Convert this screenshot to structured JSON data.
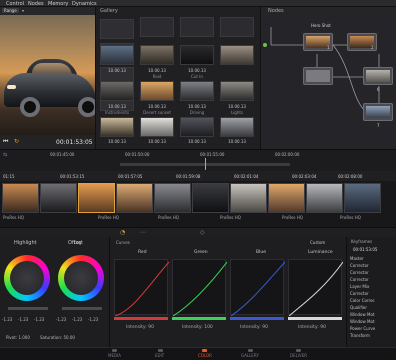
{
  "menubar": {
    "items": [
      "Control",
      "Nodes",
      "Memory",
      "Dynamics"
    ]
  },
  "viewer": {
    "dropdown": "Range",
    "timecode": "00:01:53:05"
  },
  "gallery": {
    "title": "Gallery",
    "thumbs": [
      {
        "tc": "10.00.13",
        "name": ""
      },
      {
        "tc": "10.00.13",
        "name": "Raid"
      },
      {
        "tc": "10.00.13",
        "name": "Cut In"
      },
      {
        "tc": "10.00.13",
        "name": "Instruments"
      },
      {
        "tc": "10.00.13",
        "name": "Desert sunset"
      },
      {
        "tc": "10.00.13",
        "name": "Driving"
      },
      {
        "tc": "10.00.13",
        "name": "Lights"
      },
      {
        "tc": "10.00.13",
        "name": ""
      },
      {
        "tc": "10.00.13",
        "name": ""
      },
      {
        "tc": "10.00.13",
        "name": ""
      },
      {
        "tc": "10.00.13",
        "name": ""
      }
    ]
  },
  "nodes": {
    "title": "Nodes",
    "node_title": "Hero Shot",
    "numbers": [
      "1",
      "2",
      "6",
      "7",
      "8"
    ]
  },
  "timeline": {
    "ruler": [
      "00:01:45:00",
      "00:01:50:00",
      "00:01:55:00",
      "00:02:00:00"
    ],
    "playhead_tc": "00:01:53:05",
    "clips": [
      {
        "tc": "01:15",
        "fmt": "ProRes HQ"
      },
      {
        "tc": "00:01:53:15",
        "fmt": "ProRes HQ"
      },
      {
        "tc": "00:01:57:05",
        "fmt": "ProRes HQ"
      },
      {
        "tc": "00:01:59:08",
        "fmt": "ProRes HQ"
      },
      {
        "tc": "00:02:01:04",
        "fmt": "ProRes HQ"
      },
      {
        "tc": "00:02:03:04",
        "fmt": "ProRes HQ"
      },
      {
        "tc": "00:02:08:00",
        "fmt": "ProRes HQ"
      },
      {
        "tc": "00:02:14:00",
        "fmt": "ProRes HQ"
      }
    ]
  },
  "color": {
    "wheels_header": [
      "Highlight",
      "Offset"
    ],
    "wheels_mode": "Log",
    "wheel_values": [
      "-1.23",
      "-1.23",
      "-1.23",
      "-1.23",
      "-1.23",
      "-1.23"
    ],
    "pivot": "Pivot: 1.000",
    "saturation": "Saturation: 50.00",
    "curves_title": "Curves",
    "curves": [
      {
        "name": "Red",
        "intensity": "Intensity: 90",
        "color": "#d23b3b"
      },
      {
        "name": "Green",
        "intensity": "Intensity: 100",
        "color": "#3bd25a"
      },
      {
        "name": "Blue",
        "intensity": "Intensity: 90",
        "color": "#3b5ad2"
      },
      {
        "name": "Luminance",
        "intensity": "Intensity: 90",
        "color": "#d9d9d9"
      }
    ],
    "custom": "Custom",
    "keyframes_title": "Keyframes",
    "keyframes_tc": "00:01:53:05",
    "keyframes": [
      "Master",
      "Corrector",
      "Corrector",
      "Corrector",
      "Layer Mix",
      "Corrector",
      "Color Correc",
      "Qualifier",
      "Window Mot",
      "Window Mot",
      "Power Curve",
      "Transform"
    ]
  },
  "pagebar": {
    "items": [
      "MEDIA",
      "EDIT",
      "COLOR",
      "GALLERY",
      "DELIVER"
    ],
    "active": "COLOR"
  }
}
